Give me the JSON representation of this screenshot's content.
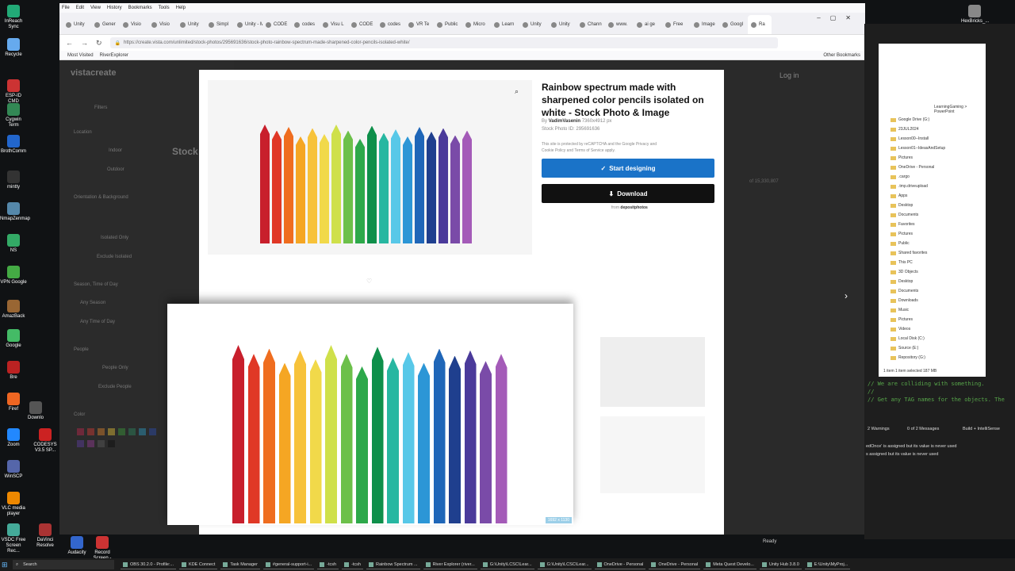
{
  "desktop": {
    "icons": [
      "InReach Sync",
      "Recycle",
      "ESP-ID CMD",
      "Cygwin Term",
      "BrothComm",
      "mintty",
      "NmapZenmap",
      "NS",
      "VPN Google",
      "AmazBack",
      "Google",
      "Bre",
      "Firef",
      "Zoom",
      "CODESYS V3.5 SP...",
      "WinSCP",
      "VLC media player",
      "DaVinci Resolve",
      "VSDC Free Screen Rec...",
      "Audacity",
      "Record Screen - FREE",
      "HexBricks_...",
      "Downlo"
    ]
  },
  "firefox": {
    "menu": [
      "File",
      "Edit",
      "View",
      "History",
      "Bookmarks",
      "Tools",
      "Help"
    ],
    "tabs": [
      "Unity",
      "Gener",
      "Visio",
      "Visio",
      "Unity",
      "Simpl",
      "Unity - M",
      "CODE",
      "codes",
      "Visu L",
      "CODE",
      "codes",
      "VR Te",
      "Public",
      "Micro",
      "Learn",
      "Unity",
      "Unity",
      "Chann",
      "www.",
      "ai ge",
      "Free",
      "Image",
      "Googl",
      "Ra"
    ],
    "url": "https://create.vista.com/unlimited/stock-photos/295691636/stock-photo-rainbow-spectrum-made-sharpened-color-pencils-isolated-white/",
    "bookmarks": [
      "Most Visited",
      "RiverExplorer"
    ],
    "other_bookmarks": "Other Bookmarks"
  },
  "site": {
    "logo": "vistacreate",
    "login": "Log in",
    "filters": "Filters",
    "location": "Location",
    "indoor": "Indoor",
    "outdoor": "Outdoor",
    "orientation": "Orientation & Background",
    "isolated_only": "Isolated Only",
    "exclude_isolated": "Exclude Isolated",
    "season": "Season, Time of Day",
    "any_season": "Any Season",
    "any_time": "Any Time of Day",
    "people": "People",
    "people_only": "People Only",
    "exclude_people": "Exclude People",
    "color": "Color",
    "stock": "Stock",
    "count": "of 15,330,807"
  },
  "modal": {
    "title": "Rainbow spectrum made with sharpened color pencils isolated on white - Stock Photo & Image",
    "by": "By",
    "author": "VadimVasenin",
    "size": "7360x4912 px",
    "photo_id": "Stock Photo ID: 295691636",
    "recaptcha": "This site is protected by reCAPTCHA and the Google Privacy and Cookie Policy and Terms of Service apply.",
    "start_designing": "Start designing",
    "download": "Download",
    "from": "from",
    "source": "depositphotos",
    "preview_size": "1692 x 1130"
  },
  "colors": {
    "primary": "#1a73c8",
    "dark": "#111111"
  },
  "swatches": [
    "#b0284a",
    "#c23a33",
    "#c97a2c",
    "#d1b136",
    "#3a8f3a",
    "#2b7d59",
    "#2c8fb3",
    "#2c4aa1",
    "#5a3c96",
    "#8a3a8a",
    "#555555",
    "#111111"
  ],
  "pencils": [
    "#c81f2c",
    "#e03826",
    "#ef6d1f",
    "#f5a623",
    "#f7c23a",
    "#f1d94a",
    "#cfe04a",
    "#6cc04a",
    "#2da84a",
    "#0e8f4a",
    "#27b7a1",
    "#58c8e8",
    "#2c96d6",
    "#1f66b8",
    "#1f3f8e",
    "#4a3a9a",
    "#7a4ba8",
    "#a45bb8"
  ],
  "vs": {
    "errors": "2 Warnings",
    "messages": "0 of 2 Messages",
    "build": "Build + IntelliSense",
    "ready": "Ready",
    "comment1": "// We are colliding with something.",
    "comment2": "//",
    "comment3": "// Get any TAG names for the objects. The",
    "warn1": "edOnce' is assigned but its value is never used",
    "warn2": "s assigned but its value is never used"
  },
  "explorer": {
    "path": "LearningGaming > PowerPoint",
    "items": [
      "Google Drive (G:)",
      "23JUL2024",
      "Lesson00--Install",
      "Lesson01--IdeasAndSetup",
      "Pictures",
      "OneDrive - Personal",
      ".cargo",
      ".tmp.driveupload",
      "Apps",
      "Desktop",
      "Documents",
      "Favorites",
      "Pictures",
      "Public",
      "Shared favorites",
      "This PC",
      "3D Objects",
      "Desktop",
      "Documents",
      "Downloads",
      "Music",
      "Pictures",
      "Videos",
      "Local Disk (C:)",
      "Source (E:)",
      "Repository (G:)"
    ],
    "status": "1 item    1 item selected 187 MB"
  },
  "taskbar": {
    "search": "Search",
    "items": [
      "OBS 30.2.0 - Profile:...",
      "KDE Connect",
      "Task Manager",
      "#general-support-i...",
      "-tcsh",
      "-tcsh",
      "Rainbow Spectrum ...",
      "River Explorer (river...",
      "G:\\Unity\\LCSC\\Lear...",
      "G:\\Unity\\LCSC\\Lear...",
      "OneDrive - Personal",
      "OneDrive - Personal",
      "Meta Quest Develo...",
      "Unity Hub 3.8.0",
      "E:\\Unity\\MyProj..."
    ]
  }
}
